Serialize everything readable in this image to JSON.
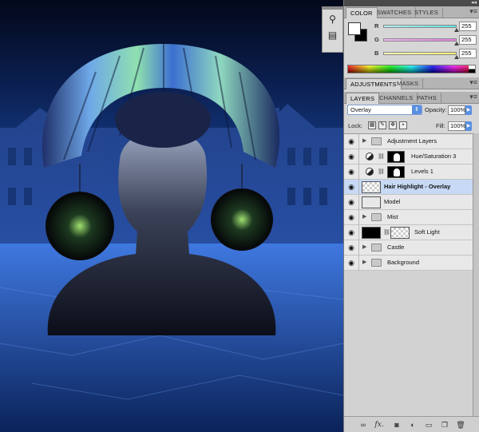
{
  "colors": {
    "panel_bg": "#d6d6d6",
    "selection": "#c7d9f5",
    "accent_blue": "#5a8fe0",
    "r_bar": "#5fe0e0",
    "g_bar": "#e07fe0",
    "b_bar": "#f0f070"
  },
  "color_panel": {
    "tabs": [
      "COLOR",
      "SWATCHES",
      "STYLES"
    ],
    "channels": [
      {
        "label": "R",
        "value": "255"
      },
      {
        "label": "G",
        "value": "255"
      },
      {
        "label": "B",
        "value": "255"
      }
    ]
  },
  "adjustments_panel": {
    "tabs": [
      "ADJUSTMENTS",
      "MASKS"
    ]
  },
  "layers_panel": {
    "tabs": [
      "LAYERS",
      "CHANNELS",
      "PATHS"
    ],
    "blend_mode": "Overlay",
    "opacity_label": "Opacity:",
    "opacity_value": "100%",
    "lock_label": "Lock:",
    "fill_label": "Fill:",
    "fill_value": "100%",
    "layers": [
      {
        "name": "Adjustment Layers",
        "type": "group"
      },
      {
        "name": "Hue/Saturation 3",
        "type": "adjustment"
      },
      {
        "name": "Levels 1",
        "type": "adjustment"
      },
      {
        "name": "Hair Highlight - Overlay",
        "type": "pixel",
        "selected": true
      },
      {
        "name": "Model",
        "type": "pixel"
      },
      {
        "name": "Mist",
        "type": "group"
      },
      {
        "name": "Soft Light",
        "type": "pixel-mask"
      },
      {
        "name": "Castle",
        "type": "group"
      },
      {
        "name": "Background",
        "type": "group"
      }
    ]
  },
  "icons": {
    "eye": "eye-icon",
    "folder": "folder-icon",
    "link": "link-icon",
    "fx": "fx-icon",
    "mask": "mask-icon",
    "adjustment": "adjustment-icon",
    "new_group": "new-group-icon",
    "new_layer": "new-layer-icon",
    "trash": "trash-icon"
  },
  "bottom_bar": {
    "fx_label": "fx."
  }
}
